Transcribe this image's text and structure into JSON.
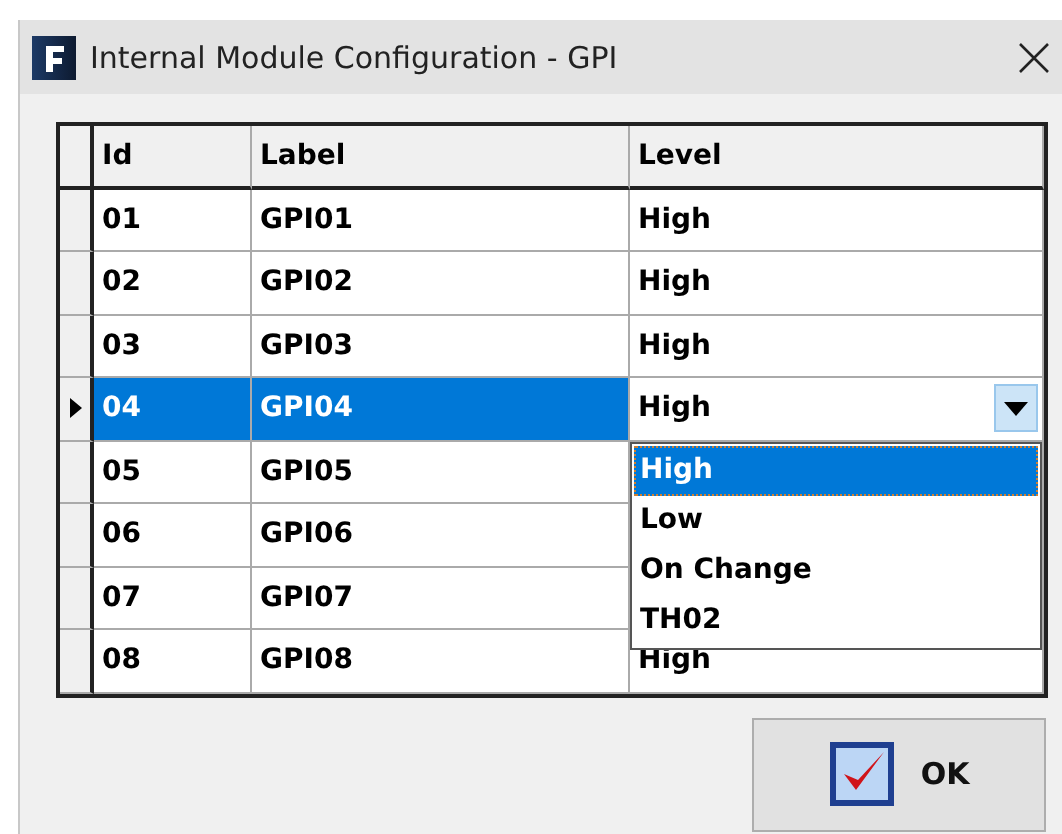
{
  "window": {
    "title": "Internal Module Configuration - GPI"
  },
  "table": {
    "columns": [
      "Id",
      "Label",
      "Level"
    ],
    "rows": [
      {
        "id": "01",
        "label": "GPI01",
        "level": "High",
        "selected": false
      },
      {
        "id": "02",
        "label": "GPI02",
        "level": "High",
        "selected": false
      },
      {
        "id": "03",
        "label": "GPI03",
        "level": "High",
        "selected": false
      },
      {
        "id": "04",
        "label": "GPI04",
        "level": "High",
        "selected": true
      },
      {
        "id": "05",
        "label": "GPI05",
        "selected": false
      },
      {
        "id": "06",
        "label": "GPI06",
        "selected": false
      },
      {
        "id": "07",
        "label": "GPI07",
        "selected": false
      },
      {
        "id": "08",
        "label": "GPI08",
        "level": "High",
        "selected": false
      }
    ]
  },
  "dropdown": {
    "options": [
      {
        "label": "High",
        "selected": true
      },
      {
        "label": "Low",
        "selected": false
      },
      {
        "label": "On Change",
        "selected": false
      },
      {
        "label": "TH02",
        "selected": false
      }
    ]
  },
  "buttons": [
    {
      "label": "OK"
    }
  ]
}
